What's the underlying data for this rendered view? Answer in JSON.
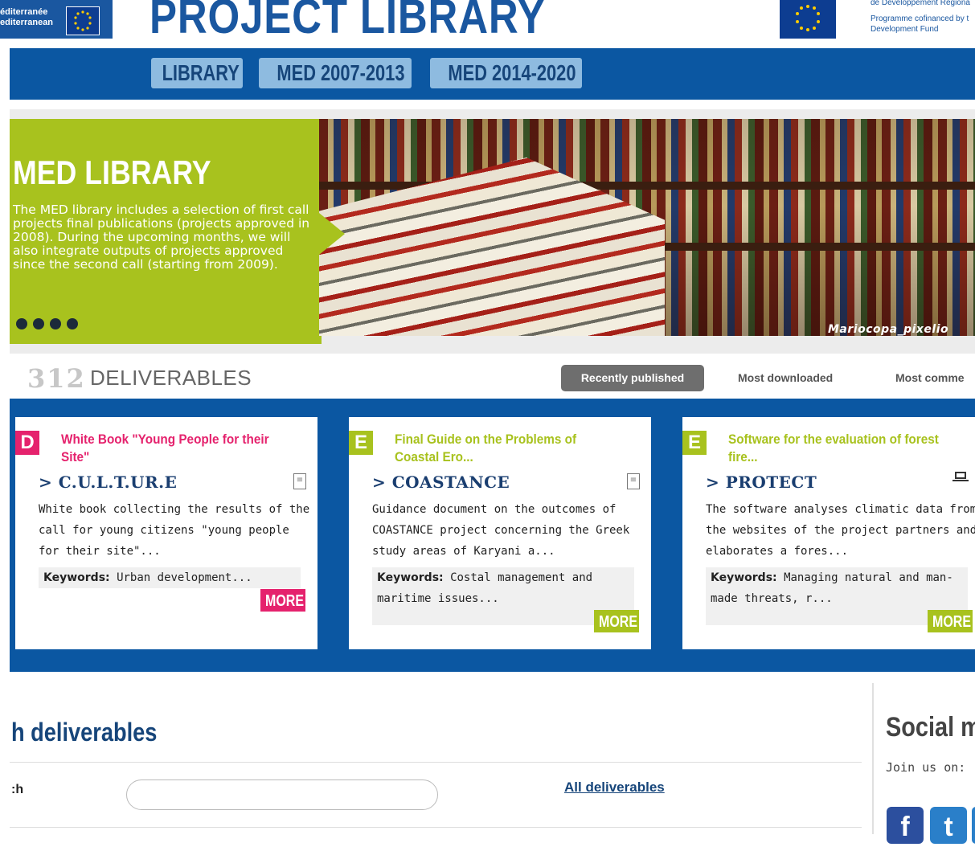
{
  "header": {
    "logo_line1": "éditerranée",
    "logo_line2": "editerranean",
    "title": "PROJECT LIBRARY",
    "eu_line1": "de Développement Régiona",
    "eu_line2": "Programme cofinanced by t",
    "eu_line3": "Development Fund"
  },
  "nav": {
    "items": [
      "LIBRARY",
      "MED 2007-2013",
      "MED 2014-2020"
    ]
  },
  "hero": {
    "title": "MED LIBRARY",
    "text": "The MED library includes a selection of first call projects final publications (projects approved in 2008). During the upcoming months, we will also integrate outputs of projects approved since the second call (starting from 2009).",
    "credit": "Mariocopa_pixelio"
  },
  "deliverables": {
    "count": "312",
    "label": "DELIVERABLES",
    "tabs": [
      "Recently published",
      "Most downloaded",
      "Most comme"
    ]
  },
  "cards": [
    {
      "letter": "D",
      "title": "White Book \"Young People for their Site\"",
      "project": "> C.U.L.T.UR.E",
      "description": "White book collecting the results of the call for young citizens \"young people for their site\"...",
      "keywords_label": "Keywords:",
      "keywords": " Urban development...",
      "more": "MORE",
      "icon": "document-icon"
    },
    {
      "letter": "E",
      "title": "Final Guide on the Problems of Coastal Ero...",
      "project": "> COASTANCE",
      "description": "Guidance document on the outcomes of COASTANCE project concerning the Greek study areas of Karyani a...",
      "keywords_label": "Keywords:",
      "keywords": " Costal management and maritime issues...",
      "more": "MORE",
      "icon": "document-icon"
    },
    {
      "letter": "E",
      "title": "Software for the evaluation of forest fire...",
      "project": "> PROTECT",
      "description": "The software analyses climatic data from the websites of the project partners and elaborates a fores...",
      "keywords_label": "Keywords:",
      "keywords": " Managing natural and man-made threats, r...",
      "more": "MORE",
      "icon": "laptop-icon"
    }
  ],
  "colors": {
    "blue": "#0b57a2",
    "green": "#a8c21e",
    "pink": "#e5226d",
    "dark_blue": "#16457a"
  },
  "search": {
    "heading": "h deliverables",
    "label": ":h",
    "placeholder": "",
    "all_link": "All deliverables"
  },
  "social": {
    "title": "Social m",
    "join": "Join us on:",
    "icons": [
      "facebook-icon",
      "twitter-icon"
    ]
  }
}
